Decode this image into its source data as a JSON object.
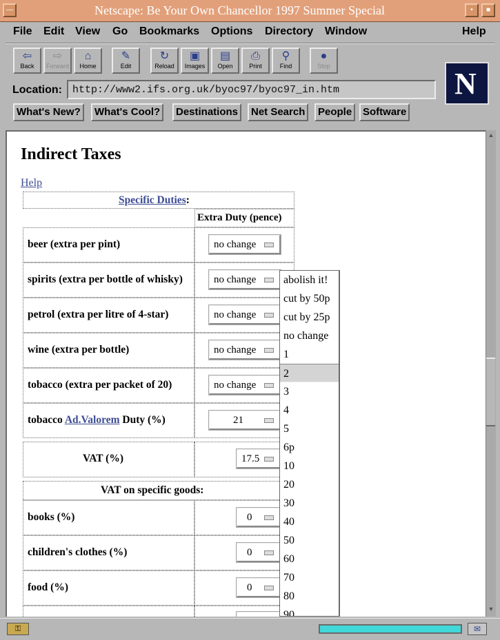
{
  "window": {
    "title": "Netscape: Be Your Own Chancellor 1997 Summer Special"
  },
  "menubar": {
    "items": [
      "File",
      "Edit",
      "View",
      "Go",
      "Bookmarks",
      "Options",
      "Directory",
      "Window"
    ],
    "help": "Help"
  },
  "toolbar": {
    "buttons": [
      {
        "label": "Back",
        "icon": "back-arrow-icon"
      },
      {
        "label": "Forward",
        "icon": "forward-arrow-icon"
      },
      {
        "label": "Home",
        "icon": "home-icon"
      },
      {
        "label": "Edit",
        "icon": "pencil-icon"
      },
      {
        "label": "Reload",
        "icon": "reload-icon"
      },
      {
        "label": "Images",
        "icon": "images-icon"
      },
      {
        "label": "Open",
        "icon": "open-icon"
      },
      {
        "label": "Print",
        "icon": "printer-icon"
      },
      {
        "label": "Find",
        "icon": "binoculars-icon"
      },
      {
        "label": "Stop",
        "icon": "stop-icon"
      }
    ]
  },
  "location": {
    "label": "Location:",
    "url": "http://www2.ifs.org.uk/byoc97/byoc97_in.htm"
  },
  "directory_buttons": [
    "What's New?",
    "What's Cool?",
    "Destinations",
    "Net Search",
    "People",
    "Software"
  ],
  "page": {
    "title": "Indirect Taxes",
    "help_link": "Help",
    "specific_duties_link": "Specific Duties",
    "specific_duties_colon": ":",
    "extra_duty_header": "Extra Duty (pence)",
    "rows": [
      {
        "label": "beer (extra per pint)",
        "value": "no change"
      },
      {
        "label": "spirits (extra per bottle of whisky)",
        "value": "no change"
      },
      {
        "label": "petrol (extra per litre of 4-star)",
        "value": "no change"
      },
      {
        "label": "wine (extra per bottle)",
        "value": "no change"
      },
      {
        "label": "tobacco (extra per packet of 20)",
        "value": "no change"
      }
    ],
    "tobacco_advalorem": {
      "prefix": "tobacco",
      "link": "Ad.Valorem",
      "suffix": "Duty (%)",
      "value": "21"
    },
    "vat": {
      "label": "VAT (%)",
      "value": "17.5"
    },
    "vat_specific_header": "VAT on specific goods:",
    "vat_rows": [
      {
        "label": "books (%)",
        "value": "0"
      },
      {
        "label": "children's clothes (%)",
        "value": "0"
      },
      {
        "label": "food (%)",
        "value": "0"
      }
    ]
  },
  "dropdown": {
    "options": [
      "abolish it!",
      "cut by 50p",
      "cut by 25p",
      "no change",
      "1",
      "2",
      "3",
      "4",
      "5",
      "6p",
      "10",
      "20",
      "30",
      "40",
      "50",
      "60",
      "70",
      "80",
      "90"
    ],
    "highlighted": "2"
  },
  "status": {
    "progress": 1.0
  }
}
